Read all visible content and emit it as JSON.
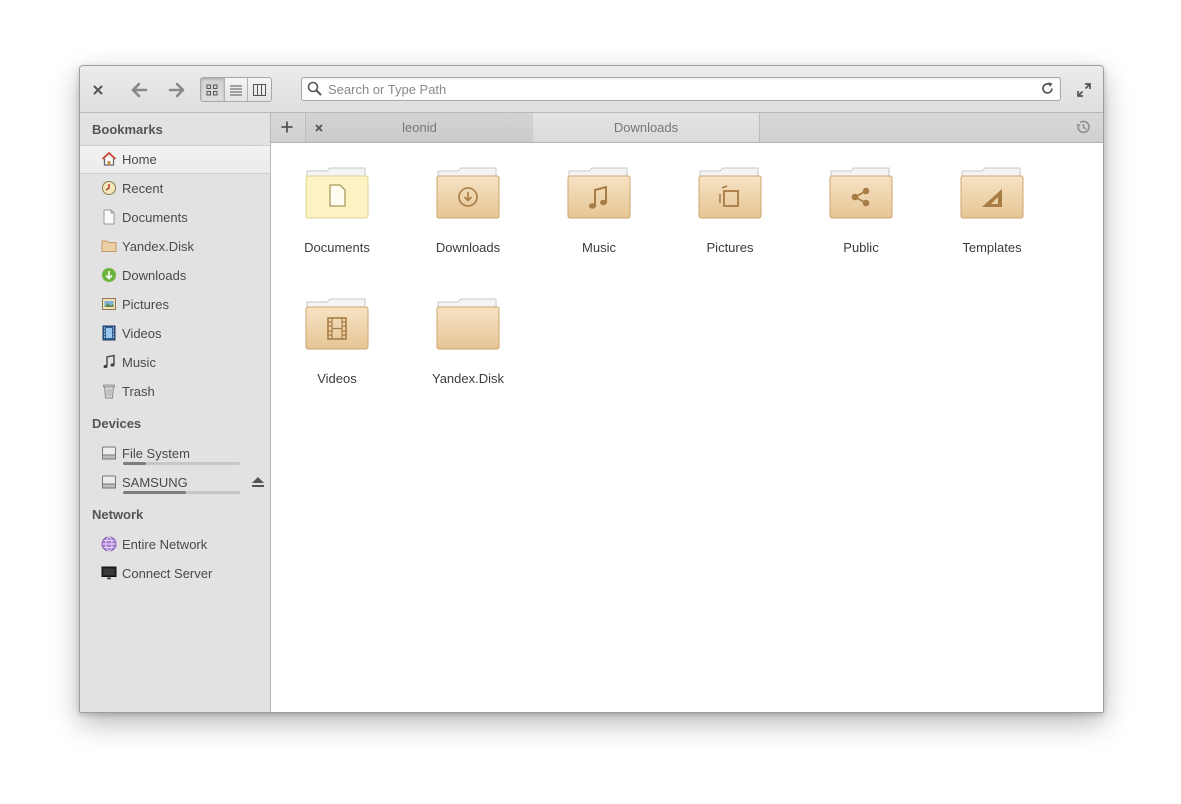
{
  "toolbar": {
    "close_icon": "close-icon",
    "back_icon": "go-back-icon",
    "forward_icon": "go-forward-icon",
    "view_modes": [
      "icon-view",
      "list-view",
      "column-view"
    ],
    "active_view": "icon-view",
    "search_placeholder": "Search or Type Path",
    "maximize_icon": "maximize-icon"
  },
  "sidebar": {
    "bookmarks_heading": "Bookmarks",
    "bookmarks": [
      {
        "label": "Home",
        "icon": "home-icon",
        "selected": true
      },
      {
        "label": "Recent",
        "icon": "recent-icon"
      },
      {
        "label": "Documents",
        "icon": "document-icon"
      },
      {
        "label": "Yandex.Disk",
        "icon": "folder-icon"
      },
      {
        "label": "Downloads",
        "icon": "download-icon"
      },
      {
        "label": "Pictures",
        "icon": "picture-icon"
      },
      {
        "label": "Videos",
        "icon": "video-icon"
      },
      {
        "label": "Music",
        "icon": "music-icon"
      },
      {
        "label": "Trash",
        "icon": "trash-icon"
      }
    ],
    "devices_heading": "Devices",
    "devices": [
      {
        "label": "File System",
        "icon": "drive-icon",
        "usage": 0.2
      },
      {
        "label": "SAMSUNG",
        "icon": "drive-icon",
        "usage": 0.54,
        "ejectable": true
      }
    ],
    "network_heading": "Network",
    "network": [
      {
        "label": "Entire Network",
        "icon": "network-icon"
      },
      {
        "label": "Connect Server",
        "icon": "server-icon"
      }
    ]
  },
  "tabs": [
    {
      "label": "leonid",
      "active": false
    },
    {
      "label": "Downloads",
      "active": true
    }
  ],
  "files": [
    {
      "label": "Documents",
      "emblem": "document"
    },
    {
      "label": "Downloads",
      "emblem": "download"
    },
    {
      "label": "Music",
      "emblem": "music"
    },
    {
      "label": "Pictures",
      "emblem": "pictures"
    },
    {
      "label": "Public",
      "emblem": "share"
    },
    {
      "label": "Templates",
      "emblem": "template"
    },
    {
      "label": "Videos",
      "emblem": "video"
    },
    {
      "label": "Yandex.Disk",
      "emblem": "none"
    }
  ],
  "colors": {
    "folder_top": "#f6e3c5",
    "folder_bottom": "#e6c594",
    "folder_tab": "#f4f4f4",
    "emblem": "#a77c45",
    "documents_folder": "#fbf3c3",
    "download_green": "#6cb33e",
    "home_red": "#d9533b"
  }
}
